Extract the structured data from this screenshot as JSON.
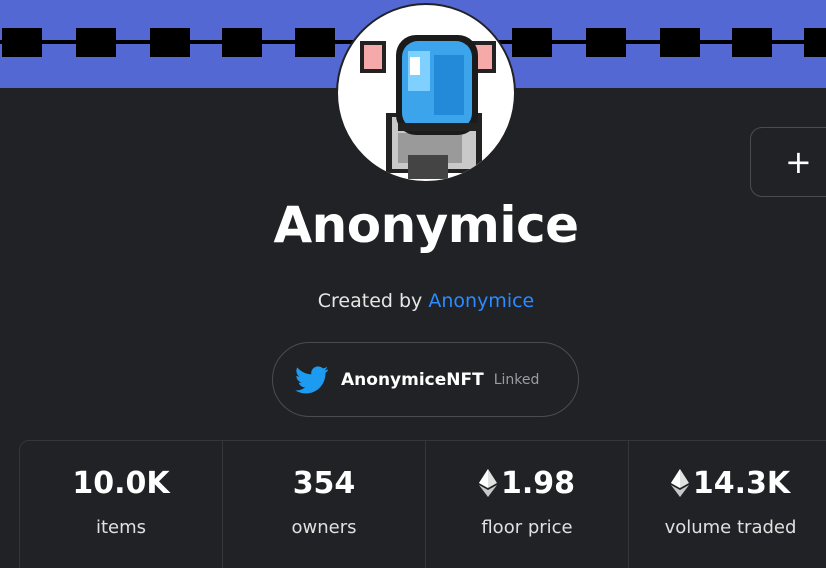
{
  "collection": {
    "name": "Anonymice",
    "created_by_prefix": "Created by",
    "creator": "Anonymice",
    "add_label": "+"
  },
  "twitter": {
    "icon": "twitter-bird-icon",
    "handle": "AnonymiceNFT",
    "status": "Linked"
  },
  "stats": [
    {
      "value": "10.0K",
      "label": "items",
      "eth_icon": false
    },
    {
      "value": "354",
      "label": "owners",
      "eth_icon": false
    },
    {
      "value": "1.98",
      "label": "floor price",
      "eth_icon": true
    },
    {
      "value": "14.3K",
      "label": "volume traded",
      "eth_icon": true
    }
  ],
  "colors": {
    "banner": "#5468d4",
    "background": "#202225",
    "link": "#2b8bff",
    "twitter": "#1d9bf0"
  }
}
